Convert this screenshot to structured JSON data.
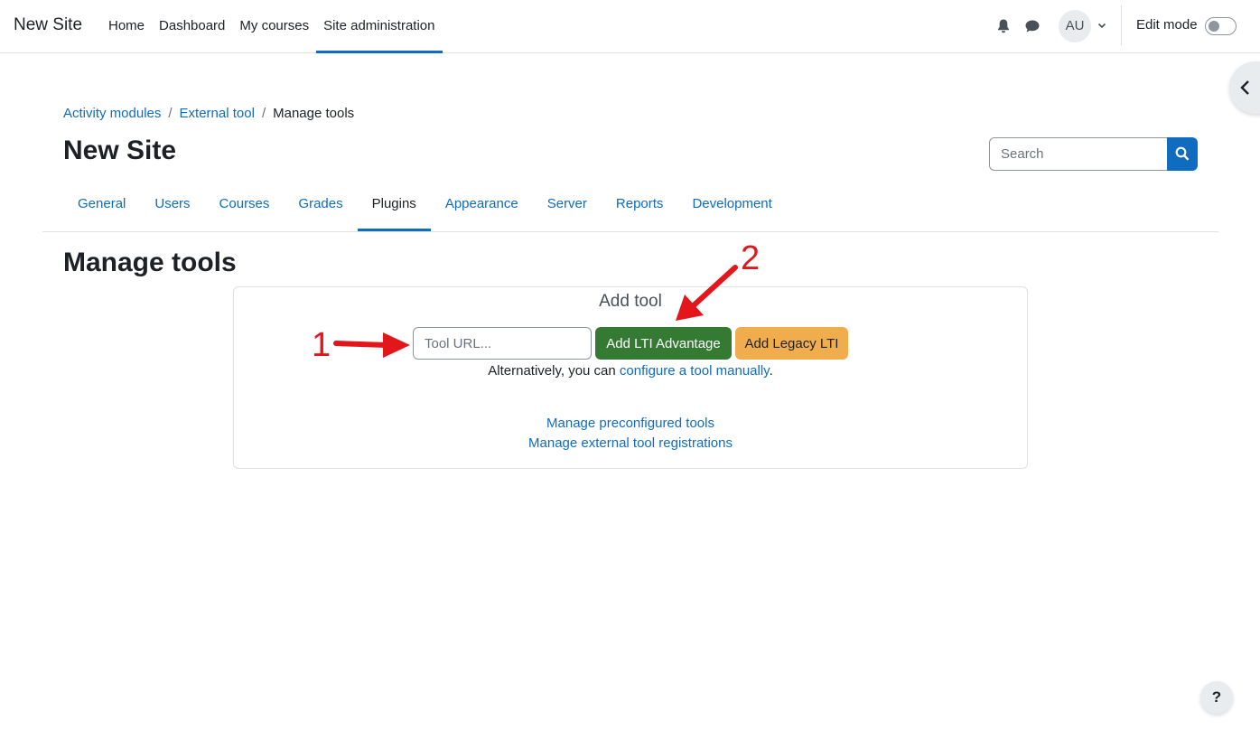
{
  "navbar": {
    "brand": "New Site",
    "items": [
      {
        "label": "Home",
        "active": false
      },
      {
        "label": "Dashboard",
        "active": false
      },
      {
        "label": "My courses",
        "active": false
      },
      {
        "label": "Site administration",
        "active": true
      }
    ],
    "avatar_initials": "AU",
    "edit_mode_label": "Edit mode",
    "edit_mode_on": false,
    "icons": [
      "bell-icon",
      "chat-icon",
      "chevron-down-icon"
    ]
  },
  "breadcrumb": {
    "items": [
      {
        "label": "Activity modules",
        "link": true
      },
      {
        "label": "External tool",
        "link": true
      },
      {
        "label": "Manage tools",
        "link": false
      }
    ],
    "separator": "/"
  },
  "page": {
    "title": "New Site",
    "section_title": "Manage tools"
  },
  "search": {
    "placeholder": "Search"
  },
  "secondary_nav": {
    "tabs": [
      {
        "label": "General",
        "active": false
      },
      {
        "label": "Users",
        "active": false
      },
      {
        "label": "Courses",
        "active": false
      },
      {
        "label": "Grades",
        "active": false
      },
      {
        "label": "Plugins",
        "active": true
      },
      {
        "label": "Appearance",
        "active": false
      },
      {
        "label": "Server",
        "active": false
      },
      {
        "label": "Reports",
        "active": false
      },
      {
        "label": "Development",
        "active": false
      }
    ]
  },
  "add_tool": {
    "title": "Add tool",
    "url_placeholder": "Tool URL...",
    "url_value": "",
    "add_lti_advantage_label": "Add LTI Advantage",
    "add_legacy_lti_label": "Add Legacy LTI",
    "alt_prefix": "Alternatively, you can ",
    "alt_link": "configure a tool manually",
    "alt_suffix": ".",
    "link_preconfigured": "Manage preconfigured tools",
    "link_registrations": "Manage external tool registrations"
  },
  "annotations": {
    "step1": "1",
    "step2": "2",
    "color": "#e3161c"
  },
  "help": {
    "label": "?"
  },
  "colors": {
    "primary": "#0f6cbf",
    "success": "#357a32",
    "warning": "#f0ad4e"
  }
}
